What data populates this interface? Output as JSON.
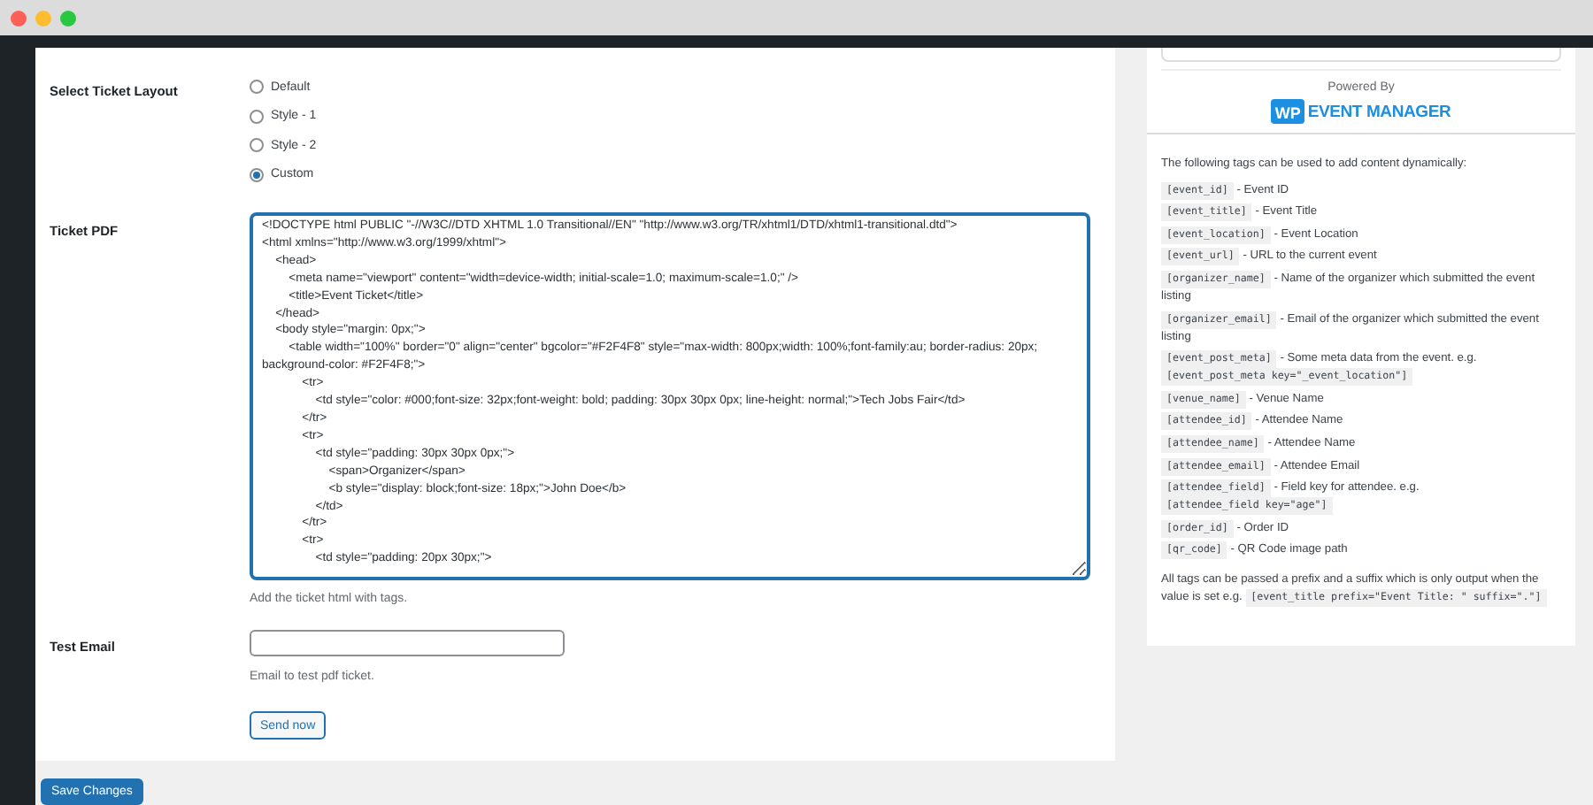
{
  "settings": {
    "layout": {
      "label": "Select Ticket Layout",
      "options": [
        {
          "label": "Default",
          "selected": false
        },
        {
          "label": "Style - 1",
          "selected": false
        },
        {
          "label": "Style - 2",
          "selected": false
        },
        {
          "label": "Custom",
          "selected": true
        }
      ]
    },
    "ticket_pdf": {
      "label": "Ticket PDF",
      "value": [
        "<!DOCTYPE html PUBLIC \"-//W3C//DTD XHTML 1.0 Transitional//EN\" \"http://www.w3.org/TR/xhtml1/DTD/xhtml1-transitional.dtd\">",
        "<html xmlns=\"http://www.w3.org/1999/xhtml\">",
        "    <head>",
        "        <meta name=\"viewport\" content=\"width=device-width; initial-scale=1.0; maximum-scale=1.0;\" />",
        "        <title>Event Ticket</title>",
        "    </head>",
        "    <body style=\"margin: 0px;\">",
        "        <table width=\"100%\" border=\"0\" align=\"center\" bgcolor=\"#F2F4F8\" style=\"max-width: 800px;width: 100%;font-family:au; border-radius: 20px; background-color: #F2F4F8;\">",
        "            <tr>",
        "                <td style=\"color: #000;font-size: 32px;font-weight: bold; padding: 30px 30px 0px; line-height: normal;\">Tech Jobs Fair</td>",
        "            </tr>",
        "            <tr>",
        "                <td style=\"padding: 30px 30px 0px;\">",
        "                    <span>Organizer</span>",
        "                    <b style=\"display: block;font-size: 18px;\">John Doe</b>",
        "                </td>",
        "            </tr>",
        "            <tr>",
        "                <td style=\"padding: 20px 30px;\">"
      ],
      "hint": "Add the ticket html with tags."
    },
    "test_email": {
      "label": "Test Email",
      "hint": "Email to test pdf ticket.",
      "button": "Send now"
    },
    "save_button": "Save Changes"
  },
  "sidebar": {
    "powered_by": "Powered By",
    "logo": {
      "mark": "WP",
      "name": "EVENT MANAGER"
    },
    "intro": "The following tags can be used to add content dynamically:",
    "tags": [
      {
        "tag": "[event_id]",
        "description": "- Event ID"
      },
      {
        "tag": "[event_title]",
        "description": "- Event Title"
      },
      {
        "tag": "[event_location]",
        "description": "- Event Location"
      },
      {
        "tag": "[event_url]",
        "description": "- URL to the current event"
      },
      {
        "tag": "[organizer_name]",
        "description": "- Name of the organizer which submitted the event listing"
      },
      {
        "tag": "[organizer_email]",
        "description": "- Email of the organizer which submitted the event listing"
      },
      {
        "tag": "[event_post_meta]",
        "description": "- Some meta data from the event. e.g.",
        "example": "[event_post_meta key=\"_event_location\"]"
      },
      {
        "tag": "[venue_name]",
        "description": "- Venue Name"
      },
      {
        "tag": "[attendee_id]",
        "description": "- Attendee Name"
      },
      {
        "tag": "[attendee_name]",
        "description": "- Attendee Name"
      },
      {
        "tag": "[attendee_email]",
        "description": "- Attendee Email"
      },
      {
        "tag": "[attendee_field]",
        "description": "- Field key for attendee. e.g.",
        "example": "[attendee_field key=\"age\"]"
      },
      {
        "tag": "[order_id]",
        "description": "- Order ID"
      },
      {
        "tag": "[qr_code]",
        "description": "- QR Code image path"
      }
    ],
    "note": {
      "text": "All tags can be passed a prefix and a suffix which is only output when the value is set e.g.",
      "example": "[event_title prefix=\"Event Title: \" suffix=\".\"]"
    }
  }
}
